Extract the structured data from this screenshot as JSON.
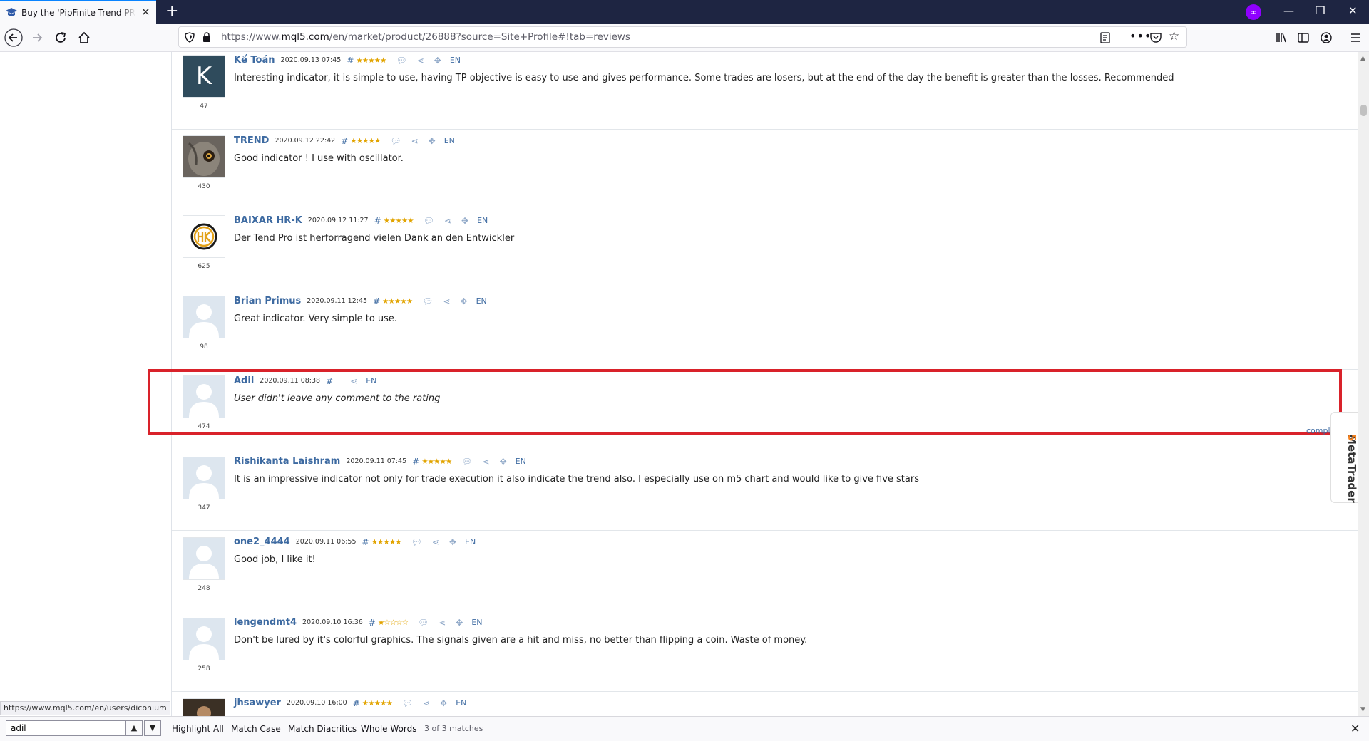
{
  "browser": {
    "tab_title": "Buy the 'PipFinite Trend PRO' Technical Indicator",
    "new_tab": "+",
    "url_prefix": "https://www.",
    "url_domain": "mql5.com",
    "url_rest": "/en/market/product/26888?source=Site+Profile#!tab=reviews",
    "status_link": "https://www.mql5.com/en/users/diconium"
  },
  "reviews": [
    {
      "user": "Kế Toán",
      "date": "2020.09.13 07:45",
      "stars": "★★★★★",
      "rating": "47",
      "text": "Interesting indicator, it is simple to use, having TP objective is easy to use and gives performance. Some trades are losers, but at the end of the day the benefit is greater than the losses. Recommended",
      "lang": "EN",
      "avatar": "K"
    },
    {
      "user": "TREND",
      "date": "2020.09.12 22:42",
      "stars": "★★★★★",
      "rating": "430",
      "text": "Good indicator ! I use with oscillator.",
      "lang": "EN",
      "avatar": "owl"
    },
    {
      "user": "BAIXAR HR-K",
      "date": "2020.09.12 11:27",
      "stars": "★★★★★",
      "rating": "625",
      "text": "Der Tend Pro ist herforragend vielen Dank an den Entwickler",
      "lang": "EN",
      "avatar": "HK"
    },
    {
      "user": "Brian Primus",
      "date": "2020.09.11 12:45",
      "stars": "★★★★★",
      "rating": "98",
      "text": "Great indicator. Very simple to use.",
      "lang": "EN",
      "avatar": "default"
    },
    {
      "user": "Adil",
      "date": "2020.09.11 08:38",
      "stars": "",
      "rating": "474",
      "text": "User didn't leave any comment to the rating",
      "lang": "EN",
      "avatar": "default"
    },
    {
      "user": "Rishikanta Laishram",
      "date": "2020.09.11 07:45",
      "stars": "★★★★★",
      "rating": "347",
      "text": "It is an impressive indicator not only for trade execution it also indicate the trend also. I especially use on m5 chart and would like to give five stars",
      "lang": "EN",
      "avatar": "default"
    },
    {
      "user": "one2_4444",
      "date": "2020.09.11 06:55",
      "stars": "★★★★★",
      "rating": "248",
      "text": "Good job, I like it!",
      "lang": "EN",
      "avatar": "default"
    },
    {
      "user": "lengendmt4",
      "date": "2020.09.10 16:36",
      "stars": "★☆☆☆☆",
      "rating": "258",
      "text": "Don't be lured by it's colorful graphics. The signals given are a hit and miss, no better than flipping a coin. Waste of money.",
      "lang": "EN",
      "avatar": "default"
    },
    {
      "user": "jhsawyer",
      "date": "2020.09.10 16:00",
      "stars": "★★★★★",
      "rating": "",
      "text": "",
      "lang": "EN",
      "avatar": "photo"
    }
  ],
  "highlight_color": "#d9222a",
  "side_widget": {
    "label": "MetaTrader",
    "version": "5",
    "compl": "compl"
  },
  "find": {
    "query": "adil",
    "highlight_all": "Highlight All",
    "match_case": "Match Case",
    "match_diacritics": "Match Diacritics",
    "whole_words": "Whole Words",
    "matches": "3 of 3 matches"
  }
}
